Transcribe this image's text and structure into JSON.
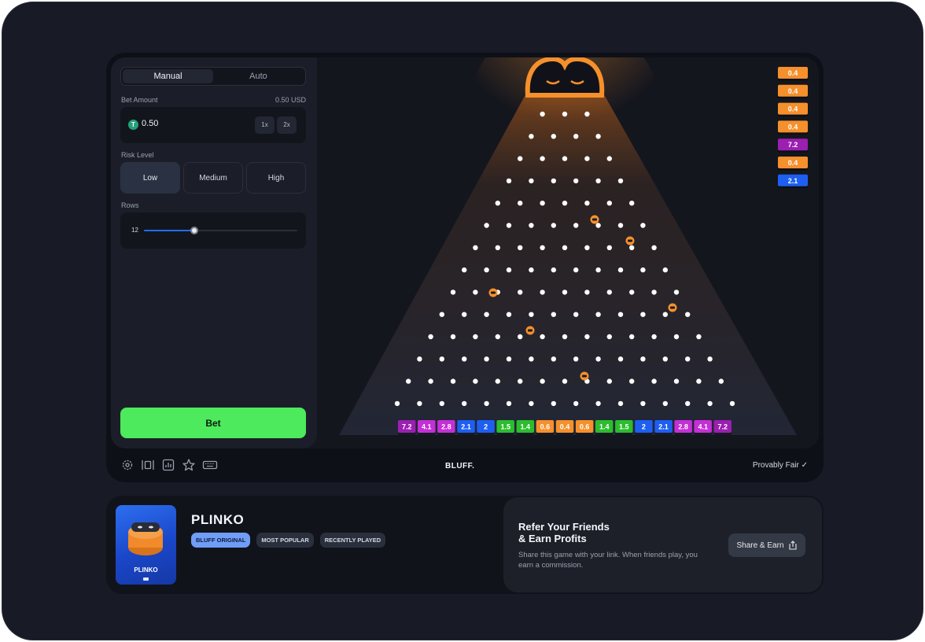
{
  "panel": {
    "tabs": [
      {
        "label": "Manual",
        "active": true
      },
      {
        "label": "Auto",
        "active": false
      }
    ],
    "bet_amount_label": "Bet Amount",
    "bet_amount_usd": "0.50 USD",
    "bet_value": "0.50",
    "currency_icon": "tether-coin-icon",
    "mult_1x": "1x",
    "mult_2x": "2x",
    "risk_label": "Risk Level",
    "risk_options": [
      {
        "label": "Low",
        "active": true
      },
      {
        "label": "Medium",
        "active": false
      },
      {
        "label": "High",
        "active": false
      }
    ],
    "rows_label": "Rows",
    "rows_value": "12",
    "rows_slider_fraction": 0.33,
    "bet_button": "Bet",
    "bet_button_color": "#4cea5c"
  },
  "board": {
    "peg_rows": 14,
    "multipliers": [
      "7.2",
      "4.1",
      "2.8",
      "2.1",
      "2",
      "1.5",
      "1.4",
      "0.6",
      "0.4",
      "0.6",
      "1.4",
      "1.5",
      "2",
      "2.1",
      "2.8",
      "4.1",
      "7.2"
    ],
    "history": [
      {
        "value": "0.4",
        "color": "#f5902c"
      },
      {
        "value": "0.4",
        "color": "#f5902c"
      },
      {
        "value": "0.4",
        "color": "#f5902c"
      },
      {
        "value": "0.4",
        "color": "#f5902c"
      },
      {
        "value": "7.2",
        "color": "#9b1fb0"
      },
      {
        "value": "0.4",
        "color": "#f5902c"
      },
      {
        "value": "2.1",
        "color": "#1d5ff0"
      }
    ],
    "ball_color": "#f5902c"
  },
  "toolbar": {
    "icons": [
      "settings-icon",
      "theatre-mode-icon",
      "stats-icon",
      "favorite-star-icon",
      "keyboard-icon"
    ],
    "brand": "BLUFF.",
    "provably_fair": "Provably Fair ✓"
  },
  "info": {
    "thumb_label": "PLINKO",
    "title": "PLINKO",
    "tags": [
      {
        "label": "BLUFF ORIGINAL",
        "primary": true
      },
      {
        "label": "MOST POPULAR",
        "primary": false
      },
      {
        "label": "RECENTLY PLAYED",
        "primary": false
      }
    ],
    "refer_title": "Refer Your Friends\n& Earn Profits",
    "refer_text": "Share this game with your link. When friends play, you earn a commission.",
    "share_button": "Share & Earn"
  }
}
